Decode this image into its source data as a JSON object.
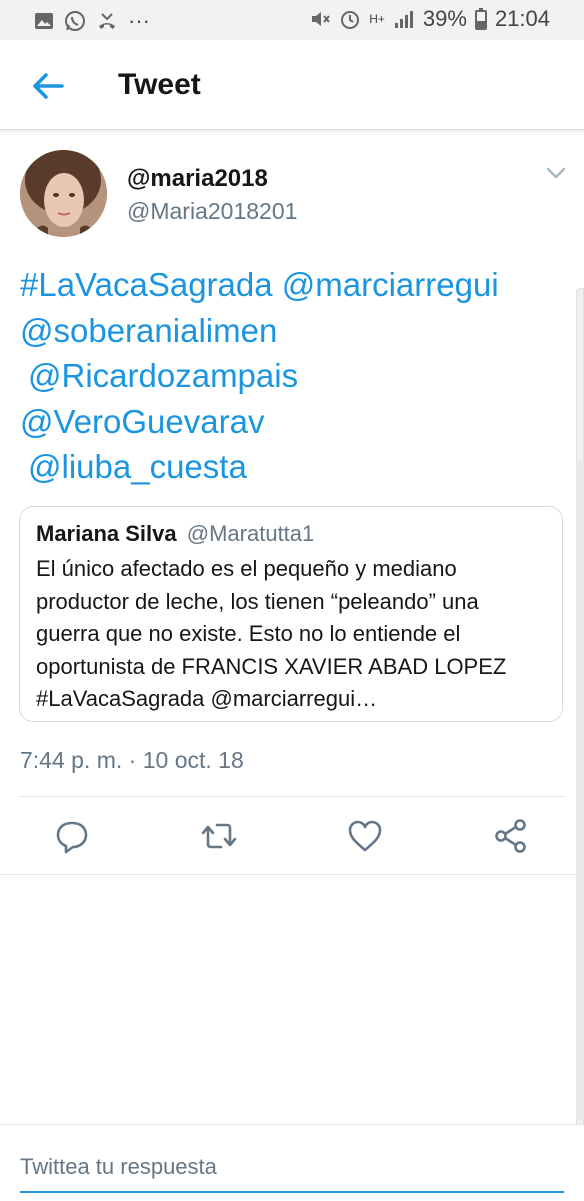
{
  "status_bar": {
    "battery": "39%",
    "time": "21:04",
    "network": "H+",
    "left_icons": [
      "image-icon",
      "whatsapp-icon",
      "missed-call-icon",
      "more-dots-icon"
    ],
    "right_icons": [
      "mute-icon",
      "alarm-icon",
      "network-icon",
      "signal-icon",
      "battery-icon"
    ]
  },
  "header": {
    "title": "Tweet"
  },
  "tweet": {
    "display_name": "@maria2018",
    "handle": "@Maria2018201",
    "text_lines": [
      "#LaVacaSagrada @marciarregui",
      "@soberanialimen",
      "@Ricardozampais",
      "@VeroGuevarav",
      "@liuba_cuesta"
    ],
    "timestamp": "7:44 p. m. · 10 oct. 18"
  },
  "quoted_tweet": {
    "name": "Mariana Silva",
    "handle": "@Maratutta1",
    "body_lines": [
      "El único afectado es el pequeño y mediano",
      "productor de leche, los tienen “peleando” una",
      "guerra que no existe. Esto no lo entiende el",
      "oportunista de FRANCIS XAVIER ABAD LOPEZ",
      "#LaVacaSagrada @marciarregui…"
    ]
  },
  "actions": [
    "reply-icon",
    "retweet-icon",
    "like-icon",
    "share-icon"
  ],
  "reply": {
    "placeholder": "Twittea tu respuesta"
  },
  "colors": {
    "accent": "#1b95e0",
    "text": "#14171a",
    "secondary": "#657786",
    "border": "#e1e8ed"
  }
}
